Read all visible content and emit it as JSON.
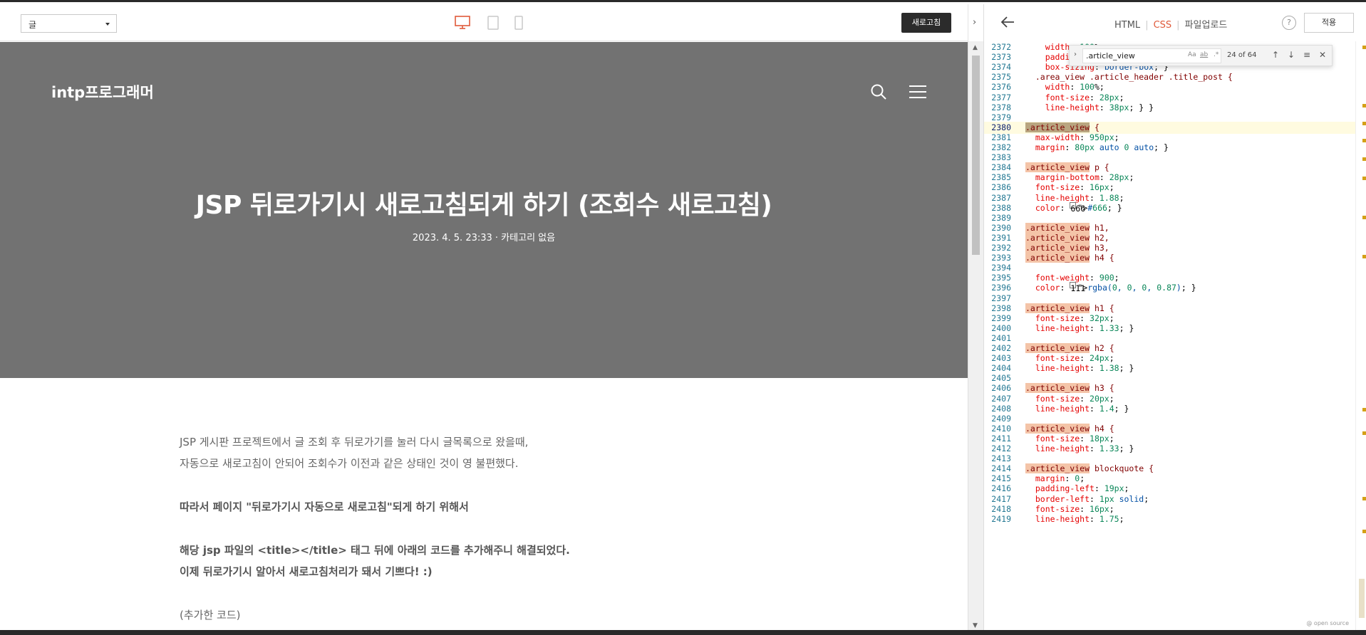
{
  "toolbar": {
    "category_select": "글",
    "refresh_label": "새로고침",
    "devices": [
      "desktop-icon",
      "tablet-icon",
      "mobile-icon"
    ]
  },
  "blog": {
    "name": "intp프로그래머",
    "post_title": "JSP 뒤로가기시 새로고침되게 하기 (조회수 새로고침)",
    "post_meta": "2023. 4. 5. 23:33 · 카테고리 없음",
    "hero_color": "#727272"
  },
  "content": {
    "lines": [
      "JSP 게시판 프로젝트에서 글 조회 후 뒤로가기를 눌러 다시 글목록으로 왔을때,",
      "자동으로 새로고침이 안되어 조회수가 이전과 같은 상태인 것이 영 불편했다.",
      "따라서 페이지 \"뒤로가기시 자동으로 새로고침\"되게 하기 위해서",
      "해당 jsp 파일의 <title></title> 태그 뒤에 아래의 코드를 추가해주니 해결되었다.",
      "이제 뒤로가기시 알아서 새로고침처리가 돼서 기쁘다! :)",
      "(추가한 코드)"
    ]
  },
  "editor": {
    "tabs": [
      "HTML",
      "CSS",
      "파일업로드"
    ],
    "active_tab": "CSS",
    "help_label": "?",
    "apply_label": "적용",
    "accent_color": "#e05a3a",
    "find": {
      "query": ".article_view",
      "count": "24 of 64",
      "options": [
        "Aa",
        "ab",
        ".*"
      ]
    },
    "open_source_label": "@ open source",
    "lines": [
      {
        "n": "2372",
        "t": "    width: 100%;"
      },
      {
        "n": "2373",
        "t": "    padding: 0;"
      },
      {
        "n": "2374",
        "t": "    box-sizing: border-box; }"
      },
      {
        "n": "2375",
        "t": "  .area_view .article_header .title_post {"
      },
      {
        "n": "2376",
        "t": "    width: 100%;"
      },
      {
        "n": "2377",
        "t": "    font-size: 28px;"
      },
      {
        "n": "2378",
        "t": "    line-height: 38px; } }"
      },
      {
        "n": "2379",
        "t": ""
      },
      {
        "n": "2380",
        "t": ".article_view {"
      },
      {
        "n": "2381",
        "t": "  max-width: 950px;"
      },
      {
        "n": "2382",
        "t": "  margin: 80px auto 0 auto; }"
      },
      {
        "n": "2383",
        "t": ""
      },
      {
        "n": "2384",
        "t": ".article_view p {"
      },
      {
        "n": "2385",
        "t": "  margin-bottom: 28px;"
      },
      {
        "n": "2386",
        "t": "  font-size: 16px;"
      },
      {
        "n": "2387",
        "t": "  line-height: 1.88;"
      },
      {
        "n": "2388",
        "t": "  color: #666; }"
      },
      {
        "n": "2389",
        "t": ""
      },
      {
        "n": "2390",
        "t": ".article_view h1,"
      },
      {
        "n": "2391",
        "t": ".article_view h2,"
      },
      {
        "n": "2392",
        "t": ".article_view h3,"
      },
      {
        "n": "2393",
        "t": ".article_view h4 {"
      },
      {
        "n": "2394",
        "t": ""
      },
      {
        "n": "2395",
        "t": "  font-weight: 900;"
      },
      {
        "n": "2396",
        "t": "  color: rgba(0, 0, 0, 0.87); }"
      },
      {
        "n": "2397",
        "t": ""
      },
      {
        "n": "2398",
        "t": ".article_view h1 {"
      },
      {
        "n": "2399",
        "t": "  font-size: 32px;"
      },
      {
        "n": "2400",
        "t": "  line-height: 1.33; }"
      },
      {
        "n": "2401",
        "t": ""
      },
      {
        "n": "2402",
        "t": ".article_view h2 {"
      },
      {
        "n": "2403",
        "t": "  font-size: 24px;"
      },
      {
        "n": "2404",
        "t": "  line-height: 1.38; }"
      },
      {
        "n": "2405",
        "t": ""
      },
      {
        "n": "2406",
        "t": ".article_view h3 {"
      },
      {
        "n": "2407",
        "t": "  font-size: 20px;"
      },
      {
        "n": "2408",
        "t": "  line-height: 1.4; }"
      },
      {
        "n": "2409",
        "t": ""
      },
      {
        "n": "2410",
        "t": ".article_view h4 {"
      },
      {
        "n": "2411",
        "t": "  font-size: 18px;"
      },
      {
        "n": "2412",
        "t": "  line-height: 1.33; }"
      },
      {
        "n": "2413",
        "t": ""
      },
      {
        "n": "2414",
        "t": ".article_view blockquote {"
      },
      {
        "n": "2415",
        "t": "  margin: 0;"
      },
      {
        "n": "2416",
        "t": "  padding-left: 19px;"
      },
      {
        "n": "2417",
        "t": "  border-left: 1px solid;"
      },
      {
        "n": "2418",
        "t": "  font-size: 16px;"
      },
      {
        "n": "2419",
        "t": "  line-height: 1.75;"
      }
    ],
    "current_line": "2380"
  }
}
